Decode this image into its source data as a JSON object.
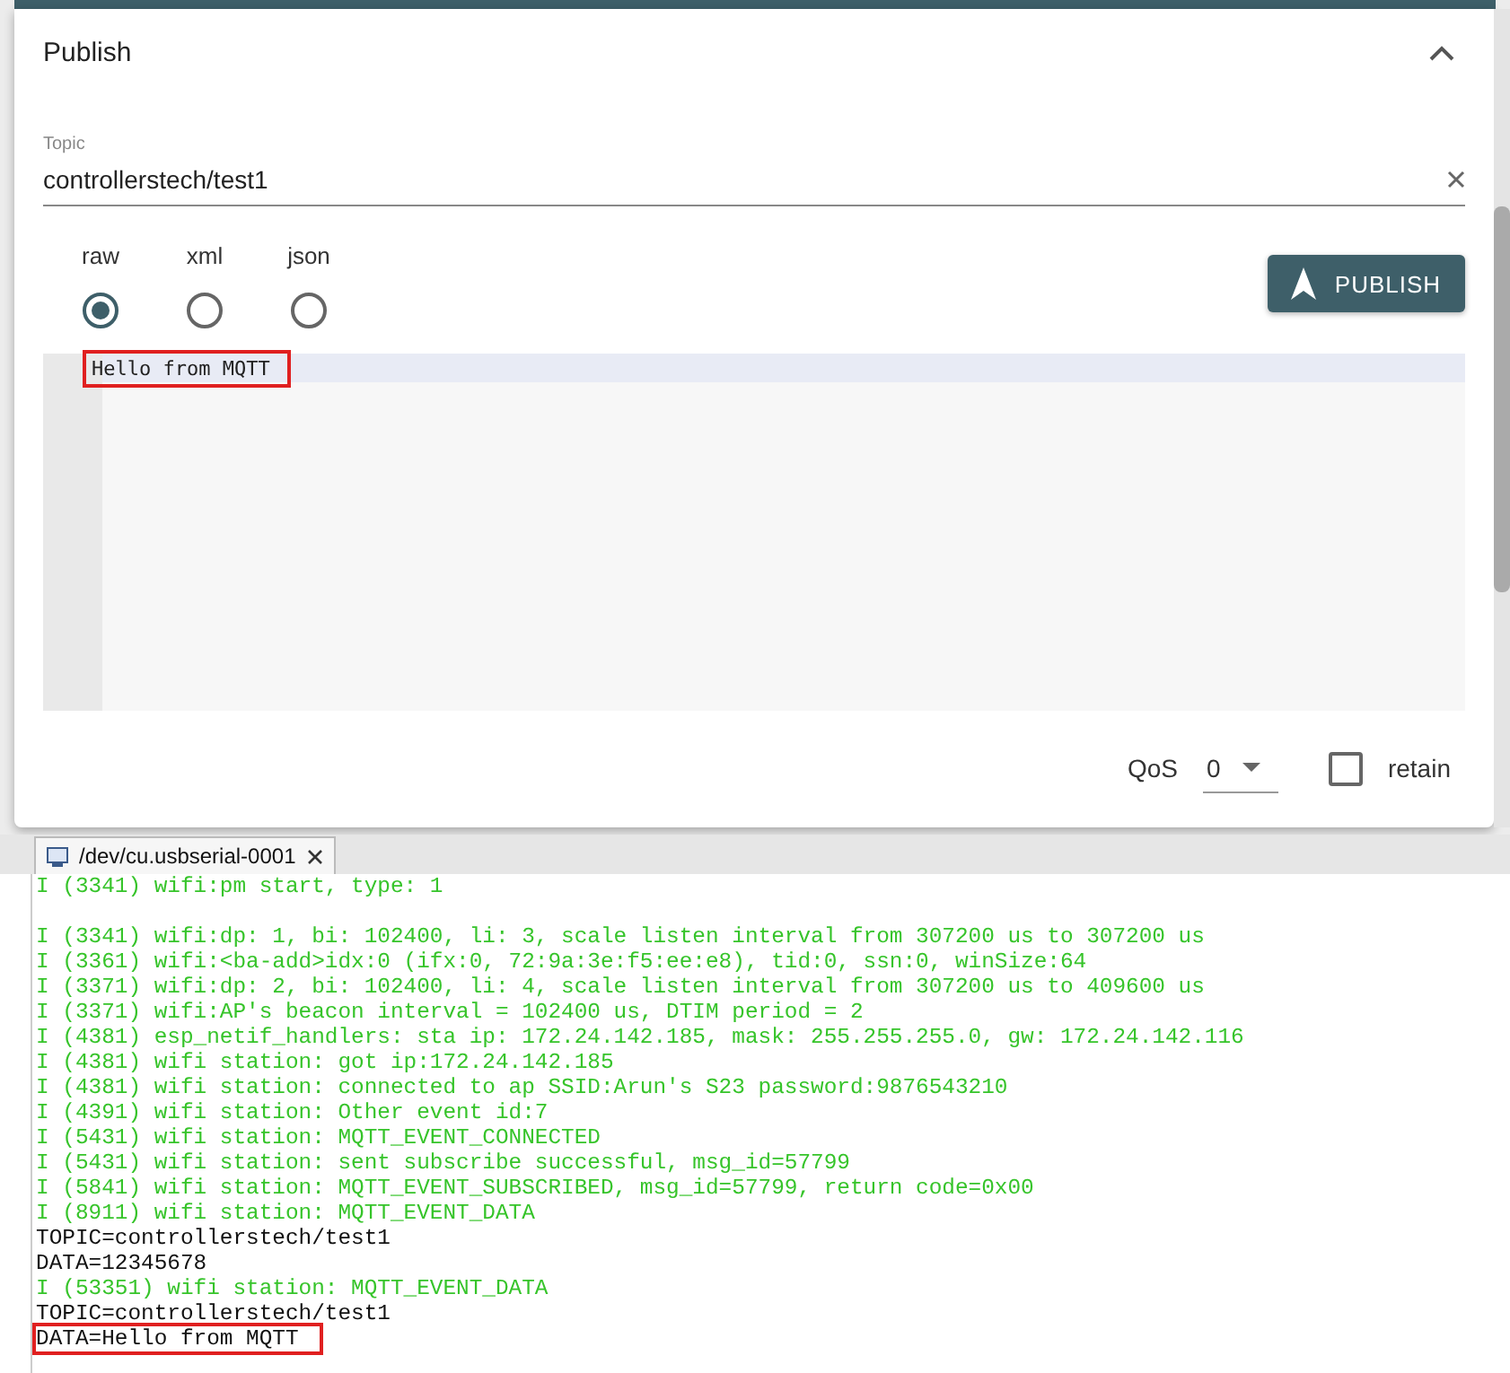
{
  "publish": {
    "title": "Publish",
    "expanded": true,
    "topic": {
      "label": "Topic",
      "value": "controllerstech/test1"
    },
    "formats": [
      {
        "label": "raw",
        "selected": true
      },
      {
        "label": "xml",
        "selected": false
      },
      {
        "label": "json",
        "selected": false
      }
    ],
    "button": "PUBLISH",
    "editor": {
      "lines": [
        {
          "text": "Hello from MQTT",
          "highlighted": true
        }
      ]
    },
    "qos": {
      "label": "QoS",
      "value": "0"
    },
    "retain": {
      "label": "retain",
      "checked": false
    }
  },
  "console": {
    "tab": {
      "label": "/dev/cu.usbserial-0001"
    },
    "lines": [
      {
        "kind": "info",
        "text": "I (3341) wifi:pm start, type: 1",
        "gap_after": true,
        "highlighted": false
      },
      {
        "kind": "info",
        "text": "I (3341) wifi:dp: 1, bi: 102400, li: 3, scale listen interval from 307200 us to 307200 us",
        "gap_after": false,
        "highlighted": false
      },
      {
        "kind": "info",
        "text": "I (3361) wifi:<ba-add>idx:0 (ifx:0, 72:9a:3e:f5:ee:e8), tid:0, ssn:0, winSize:64",
        "gap_after": false,
        "highlighted": false
      },
      {
        "kind": "info",
        "text": "I (3371) wifi:dp: 2, bi: 102400, li: 4, scale listen interval from 307200 us to 409600 us",
        "gap_after": false,
        "highlighted": false
      },
      {
        "kind": "info",
        "text": "I (3371) wifi:AP's beacon interval = 102400 us, DTIM period = 2",
        "gap_after": false,
        "highlighted": false
      },
      {
        "kind": "info",
        "text": "I (4381) esp_netif_handlers: sta ip: 172.24.142.185, mask: 255.255.255.0, gw: 172.24.142.116",
        "gap_after": false,
        "highlighted": false
      },
      {
        "kind": "info",
        "text": "I (4381) wifi station: got ip:172.24.142.185",
        "gap_after": false,
        "highlighted": false
      },
      {
        "kind": "info",
        "text": "I (4381) wifi station: connected to ap SSID:Arun's S23 password:9876543210",
        "gap_after": false,
        "highlighted": false
      },
      {
        "kind": "info",
        "text": "I (4391) wifi station: Other event id:7",
        "gap_after": false,
        "highlighted": false
      },
      {
        "kind": "info",
        "text": "I (5431) wifi station: MQTT_EVENT_CONNECTED",
        "gap_after": false,
        "highlighted": false
      },
      {
        "kind": "info",
        "text": "I (5431) wifi station: sent subscribe successful, msg_id=57799",
        "gap_after": false,
        "highlighted": false
      },
      {
        "kind": "info",
        "text": "I (5841) wifi station: MQTT_EVENT_SUBSCRIBED, msg_id=57799, return code=0x00",
        "gap_after": false,
        "highlighted": false
      },
      {
        "kind": "info",
        "text": "I (8911) wifi station: MQTT_EVENT_DATA",
        "gap_after": false,
        "highlighted": false
      },
      {
        "kind": "plain",
        "text": "TOPIC=controllerstech/test1",
        "gap_after": false,
        "highlighted": false
      },
      {
        "kind": "plain",
        "text": "DATA=12345678",
        "gap_after": false,
        "highlighted": false
      },
      {
        "kind": "info",
        "text": "I (53351) wifi station: MQTT_EVENT_DATA",
        "gap_after": false,
        "highlighted": false
      },
      {
        "kind": "plain",
        "text": "TOPIC=controllerstech/test1",
        "gap_after": false,
        "highlighted": false
      },
      {
        "kind": "plain",
        "text": "DATA=Hello from MQTT",
        "gap_after": false,
        "highlighted": true
      }
    ]
  }
}
